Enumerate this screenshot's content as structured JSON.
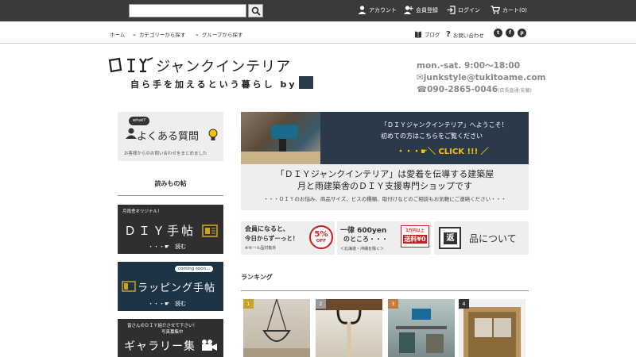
{
  "topbar": {
    "search_placeholder": "",
    "account": "アカウント",
    "register": "会員登録",
    "login": "ログイン",
    "cart": "カート(0)"
  },
  "nav": {
    "home": "ホーム",
    "category": "カテゴリーから探す",
    "group": "グループから探す",
    "blog": "ブログ",
    "contact": "お問い合わせ",
    "sns": [
      "t",
      "f",
      "p"
    ]
  },
  "logo": {
    "main": "ジャンクインテリア",
    "sub": "自ら手を加えるという暮らし by"
  },
  "contact": {
    "hours": "mon.-sat. 9:00～18:00",
    "email": "✉junkstyle@tukitoame.com",
    "phone": "☎090-2865-0046",
    "phone_note": "(店長直通:安藤)"
  },
  "sidebar": {
    "faq": {
      "bubble": "what?",
      "title": "よくある質問",
      "sub": "お客様からのお問い合わせをまとめました"
    },
    "heading": "読みもの帖",
    "diy": {
      "tag": "月雨舎オリジナル！",
      "title": "ＤＩＹ手帖",
      "read": "・・・☛　読む"
    },
    "wrapping": {
      "tag": "coming soon...",
      "title": "ラッピング手帖",
      "read": "・・・☛　読む"
    },
    "gallery": {
      "tag": "皆さんのＤＩＹ紹介させて下さい！",
      "tag2": "写真募集中",
      "title": "ギャラリー集"
    }
  },
  "banner": {
    "line1": "「ＤＩＹジャンクインテリア」へようこそ！",
    "line2": "初めての方はこちらをご覧ください",
    "cta": "・・・☛＼ CLICK !!! ／"
  },
  "intro": {
    "line1": "「ＤＩＹジャンクインテリア」は愛着を伝導する建築屋",
    "line2": "月と雨建築舎のＤＩＹ支援専門ショップです",
    "line3": "・・・ＤＩＹのお悩み、商品サイズ、ビスの種類、取付けなどのご相談もお気軽にご連絡ください・・・"
  },
  "promos": {
    "member": {
      "l1": "会員になると、",
      "l2": "今日からずーっと！",
      "note": "※セール品対象外",
      "badge_pct": "5%",
      "badge_off": "OFF"
    },
    "shipping": {
      "l1": "一律 600yen",
      "l2": "のところ・・・",
      "note": "＜北海道・沖縄を除く＞",
      "badge_top": "1万円以上",
      "badge_main": "送料¥0"
    },
    "returns": {
      "icon": "返",
      "text": "品について"
    }
  },
  "ranking": {
    "title": "ランキング",
    "items": [
      {
        "rank": "1",
        "color": "#c9a227"
      },
      {
        "rank": "2",
        "color": "#9a9a9a"
      },
      {
        "rank": "3",
        "color": "#c87a3a"
      },
      {
        "rank": "4",
        "color": "#333333"
      }
    ]
  }
}
